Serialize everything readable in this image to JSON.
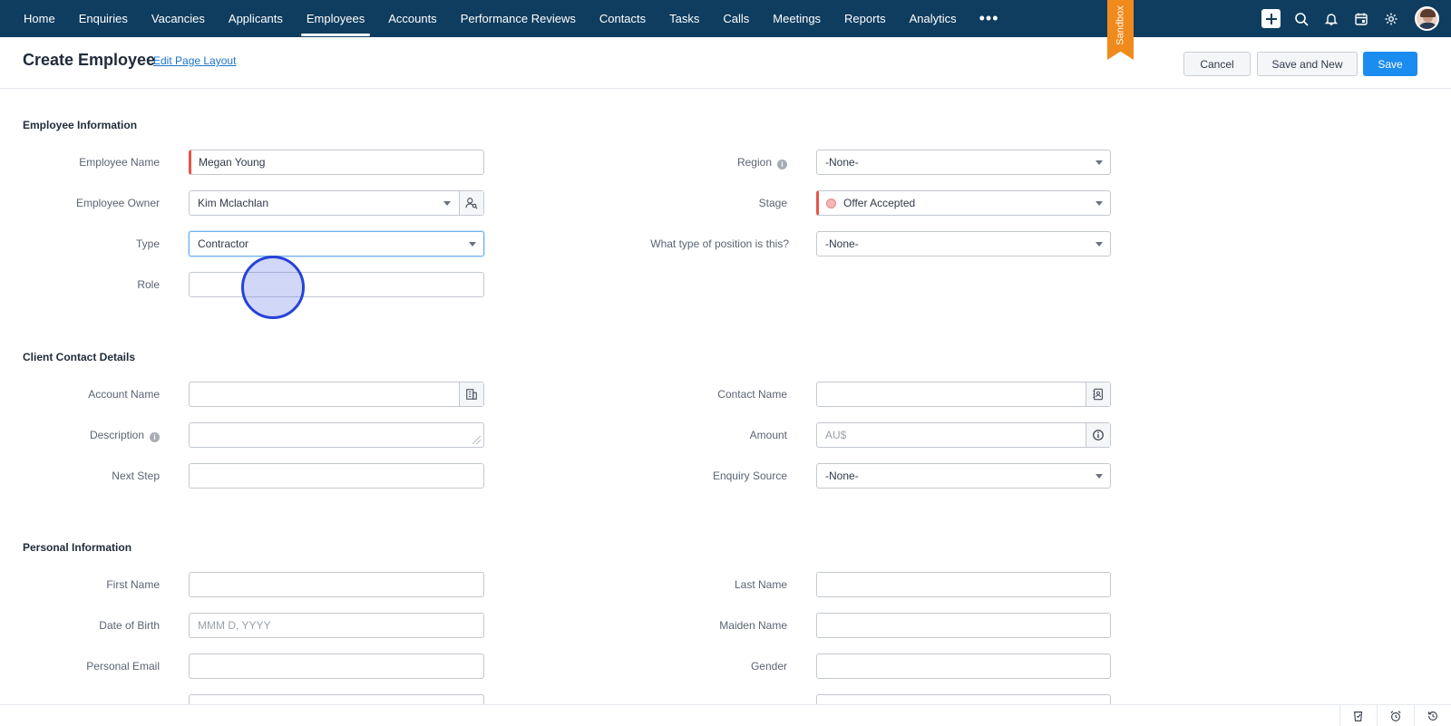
{
  "nav": {
    "items": [
      {
        "label": "Home"
      },
      {
        "label": "Enquiries"
      },
      {
        "label": "Vacancies"
      },
      {
        "label": "Applicants"
      },
      {
        "label": "Employees",
        "active": true
      },
      {
        "label": "Accounts"
      },
      {
        "label": "Performance Reviews"
      },
      {
        "label": "Contacts"
      },
      {
        "label": "Tasks"
      },
      {
        "label": "Calls"
      },
      {
        "label": "Meetings"
      },
      {
        "label": "Reports"
      },
      {
        "label": "Analytics"
      }
    ],
    "more": "•••",
    "sandbox": "Sandbox",
    "icons": [
      "plus-icon",
      "search-icon",
      "bell-icon",
      "calendar-icon",
      "gear-icon"
    ]
  },
  "header": {
    "title": "Create Employee",
    "edit_layout": "Edit Page Layout",
    "cancel": "Cancel",
    "save_new": "Save and New",
    "save": "Save"
  },
  "sections": {
    "employee_info": {
      "title": "Employee Information",
      "employee_name": {
        "label": "Employee Name",
        "value": "Megan Young"
      },
      "employee_owner": {
        "label": "Employee Owner",
        "value": "Kim Mclachlan"
      },
      "type": {
        "label": "Type",
        "value": "Contractor"
      },
      "role": {
        "label": "Role",
        "value": ""
      },
      "region": {
        "label": "Region",
        "value": "-None-"
      },
      "stage": {
        "label": "Stage",
        "value": "Offer Accepted"
      },
      "position_type": {
        "label": "What type of position is this?",
        "value": "-None-"
      }
    },
    "client_contact": {
      "title": "Client Contact Details",
      "account_name": {
        "label": "Account Name",
        "value": ""
      },
      "description": {
        "label": "Description",
        "value": ""
      },
      "next_step": {
        "label": "Next Step",
        "value": ""
      },
      "contact_name": {
        "label": "Contact Name",
        "value": ""
      },
      "amount": {
        "label": "Amount",
        "prefix": "AU$"
      },
      "enquiry_source": {
        "label": "Enquiry Source",
        "value": "-None-"
      }
    },
    "personal_info": {
      "title": "Personal Information",
      "first_name": {
        "label": "First Name",
        "value": ""
      },
      "date_of_birth": {
        "label": "Date of Birth",
        "placeholder": "MMM D, YYYY"
      },
      "personal_email": {
        "label": "Personal Email",
        "value": ""
      },
      "last_name": {
        "label": "Last Name",
        "value": ""
      },
      "maiden_name": {
        "label": "Maiden Name",
        "value": ""
      },
      "gender": {
        "label": "Gender",
        "value": ""
      }
    }
  },
  "colors": {
    "nav_bg": "#0f3d5f",
    "primary": "#1b8df0",
    "sandbox": "#f08a1c",
    "required": "#e8534a"
  }
}
